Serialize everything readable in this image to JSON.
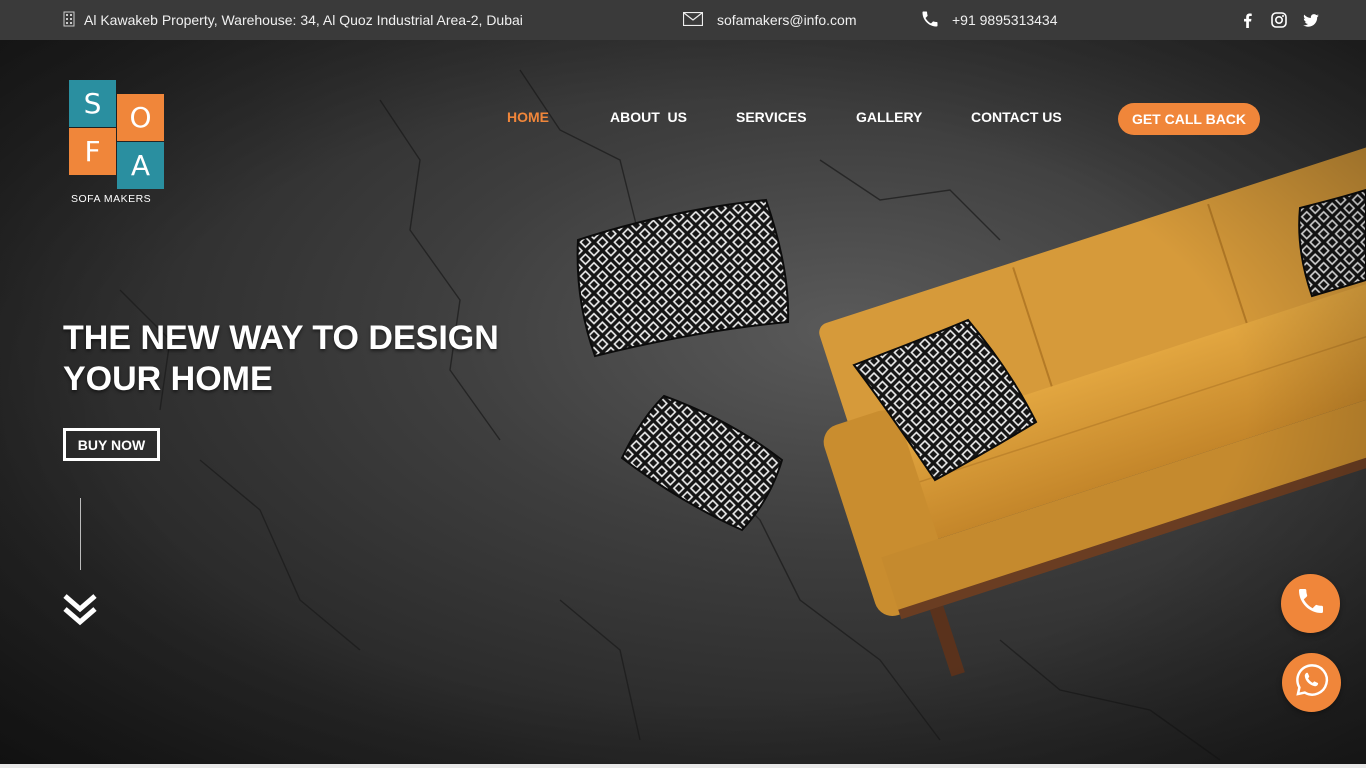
{
  "topbar": {
    "address": "Al Kawakeb Property, Warehouse: 34, Al Quoz Industrial Area-2, Dubai",
    "email": "sofamakers@info.com",
    "phone": "+91 9895313434",
    "social_icons": [
      "facebook-icon",
      "instagram-icon",
      "twitter-icon"
    ]
  },
  "logo": {
    "letters": [
      "S",
      "O",
      "F",
      "A"
    ],
    "text": "SOFA MAKERS"
  },
  "nav": {
    "items": [
      {
        "label": "HOME",
        "active": true
      },
      {
        "label": "ABOUT  US",
        "active": false
      },
      {
        "label": "SERVICES",
        "active": false
      },
      {
        "label": "GALLERY",
        "active": false
      },
      {
        "label": "CONTACT US",
        "active": false
      }
    ],
    "cta": "GET CALL BACK"
  },
  "hero": {
    "headline_line1": "THE NEW WAY TO DESIGN",
    "headline_line2": "YOUR HOME",
    "button": "BUY NOW"
  },
  "colors": {
    "accent": "#f0863a",
    "teal": "#2a8fa0",
    "topbar": "#3a3a3a",
    "sofa": "#d99a33"
  }
}
